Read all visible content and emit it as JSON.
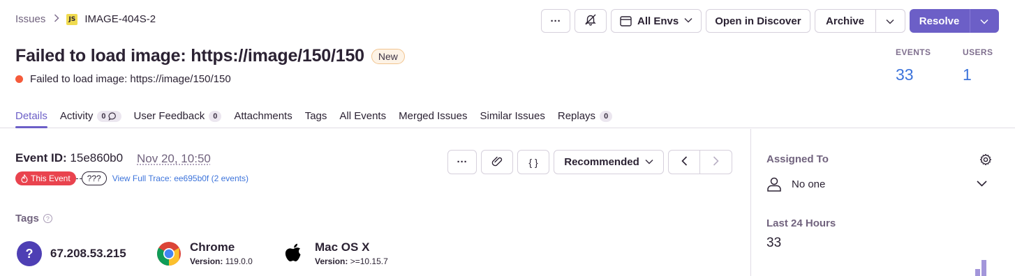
{
  "breadcrumb": {
    "root": "Issues",
    "platform_badge": "JS",
    "short_id": "IMAGE-404S-2"
  },
  "actions": {
    "more": "···",
    "envs_label": "All Envs",
    "discover_label": "Open in Discover",
    "archive_label": "Archive",
    "resolve_label": "Resolve"
  },
  "issue": {
    "title": "Failed to load image: https://image/150/150",
    "status_badge": "New",
    "subtitle": "Failed to load image: https://image/150/150",
    "level_color": "#f55b3b"
  },
  "stats": [
    {
      "label": "EVENTS",
      "value": "33"
    },
    {
      "label": "USERS",
      "value": "1"
    }
  ],
  "tabs": [
    {
      "label": "Details",
      "active": true
    },
    {
      "label": "Activity",
      "count": "0",
      "icon": "chat-icon"
    },
    {
      "label": "User Feedback",
      "count": "0"
    },
    {
      "label": "Attachments"
    },
    {
      "label": "Tags"
    },
    {
      "label": "All Events"
    },
    {
      "label": "Merged Issues"
    },
    {
      "label": "Similar Issues"
    },
    {
      "label": "Replays",
      "count": "0"
    }
  ],
  "event": {
    "id_label": "Event ID:",
    "id_value": "15e860b0",
    "date": "Nov 20, 10:50",
    "this_event": "This Event",
    "unknown": "???",
    "trace_link": "View Full Trace: ee695b0f (2 events)",
    "more": "···",
    "json": "{ }",
    "recommended": "Recommended"
  },
  "tags": {
    "header": "Tags",
    "help": "?",
    "contexts": [
      {
        "icon": "user-unknown-icon",
        "glyph": "?",
        "name": "67.208.53.215"
      },
      {
        "icon": "chrome-icon",
        "name": "Chrome",
        "version_label": "Version:",
        "version": "119.0.0"
      },
      {
        "icon": "apple-icon",
        "name": "Mac OS X",
        "version_label": "Version:",
        "version": ">=10.15.7"
      }
    ]
  },
  "sidebar": {
    "assigned_to": "Assigned To",
    "assignee": "No one",
    "last_24_label": "Last 24 Hours",
    "last_24_value": "33",
    "spark_levels": [
      0.4,
      0.9
    ]
  },
  "colors": {
    "accent": "#6c5fc7",
    "link": "#3d74db",
    "danger": "#e9434e"
  }
}
